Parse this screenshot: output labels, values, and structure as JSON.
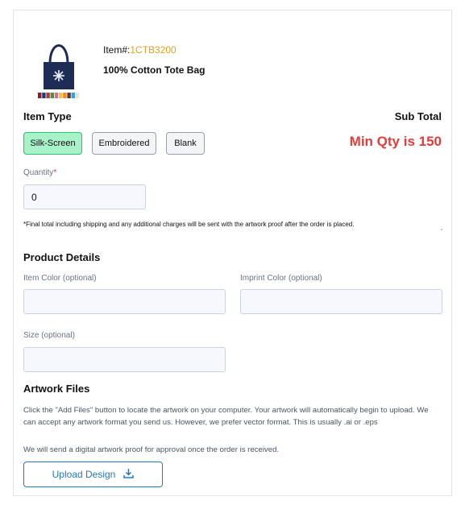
{
  "product": {
    "item_prefix": "Item#:",
    "item_code": "1CTB3200",
    "title": "100% Cotton Tote Bag",
    "swatch_colors": [
      "#8b1e1e",
      "#1f3f7a",
      "#b33a3a",
      "#4e8f3a",
      "#d96b9e",
      "#f2c24a",
      "#ef8a2d",
      "#5a3a2a",
      "#3aa0d9",
      "#e9e6d9"
    ]
  },
  "item_type": {
    "heading": "Item Type",
    "options": [
      {
        "label": "Silk-Screen",
        "active": true
      },
      {
        "label": "Embroidered",
        "active": false
      },
      {
        "label": "Blank",
        "active": false
      }
    ]
  },
  "sub_total": {
    "heading": "Sub Total",
    "message": "Min Qty is 150"
  },
  "quantity": {
    "label": "Quantity",
    "required_mark": "*",
    "value": "0"
  },
  "final_note": "*Final total including shipping and any additional charges will be sent with the artwork proof after the order is placed.",
  "product_details": {
    "heading": "Product Details",
    "item_color_label": "Item Color (optional)",
    "imprint_color_label": "Imprint Color (optional)",
    "size_label": "Size (optional)"
  },
  "artwork": {
    "heading": "Artwork Files",
    "instructions": "Click the \"Add Files\" button to locate the artwork on your computer. Your artwork will automatically begin to upload. We can accept any artwork format you send us. However, we prefer vector format. This is usually .ai or .eps",
    "proof_note": "We will send a digital artwork proof for approval once the order is received.",
    "upload_label": "Upload Design",
    "upload_icon": "download-icon"
  },
  "colors": {
    "accent": "#1f7ac2",
    "active_option": "#a7f2c9",
    "error": "#e53b3b",
    "item_code": "#e3a21a",
    "bag": "#1d2d55"
  }
}
